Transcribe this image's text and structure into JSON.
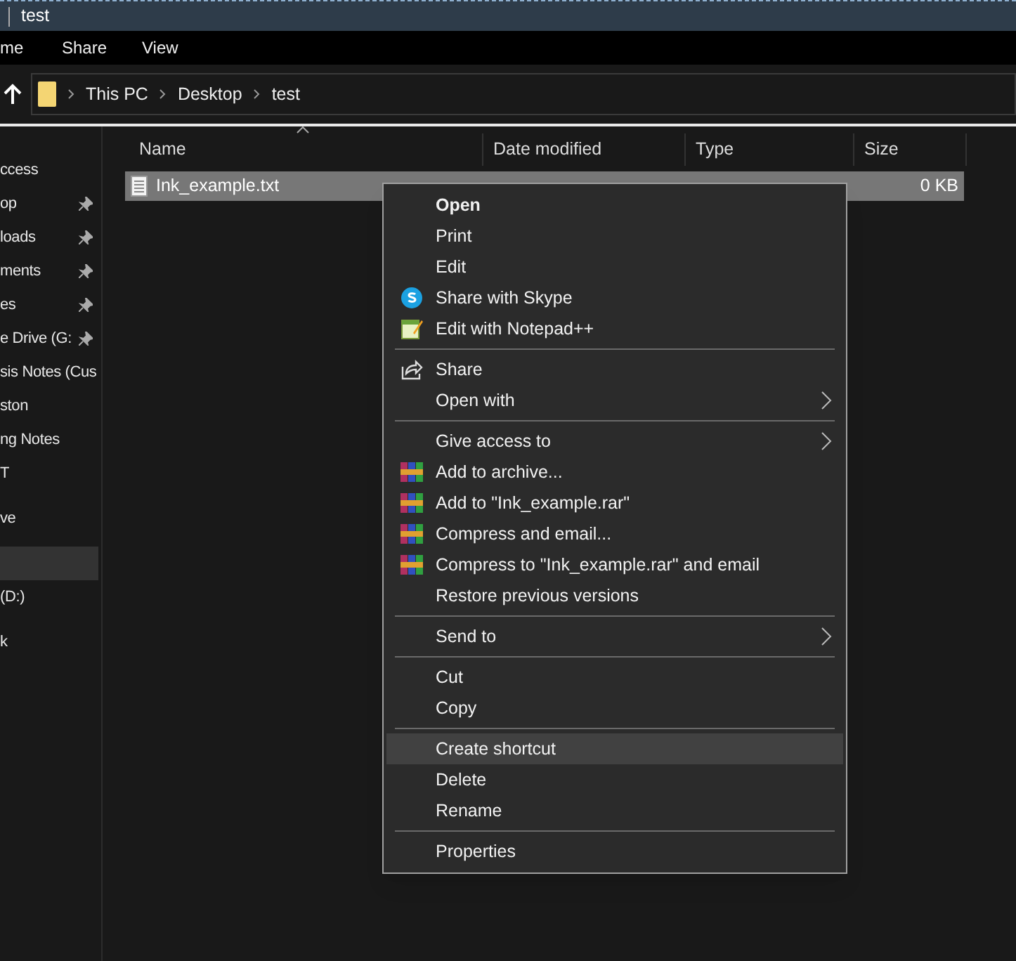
{
  "window": {
    "title": "test"
  },
  "ribbon_tabs": [
    {
      "label": "me"
    },
    {
      "label": "Share"
    },
    {
      "label": "View"
    }
  ],
  "address": {
    "crumbs": [
      "This PC",
      "Desktop",
      "test"
    ]
  },
  "sidebar": {
    "groups": [
      {
        "items": [
          {
            "label": "ccess",
            "pinned": false,
            "selected": false
          },
          {
            "label": "op",
            "pinned": true,
            "selected": false
          },
          {
            "label": "loads",
            "pinned": true,
            "selected": false
          },
          {
            "label": "ments",
            "pinned": true,
            "selected": false
          },
          {
            "label": "es",
            "pinned": true,
            "selected": false
          },
          {
            "label": "e Drive (G:",
            "pinned": true,
            "selected": false
          },
          {
            "label": "sis Notes (Cus",
            "pinned": false,
            "selected": false
          },
          {
            "label": "ston",
            "pinned": false,
            "selected": false
          },
          {
            "label": "ng Notes",
            "pinned": false,
            "selected": false
          },
          {
            "label": "T",
            "pinned": false,
            "selected": false
          }
        ]
      },
      {
        "items": [
          {
            "label": "ve",
            "pinned": false,
            "selected": false
          }
        ]
      },
      {
        "items": [
          {
            "pinned": false,
            "selected": true
          },
          {
            "label": "(D:)",
            "pinned": false,
            "selected": false
          }
        ]
      },
      {
        "items": [
          {
            "label": "k",
            "pinned": false,
            "selected": false
          }
        ]
      }
    ]
  },
  "table": {
    "columns": [
      "Name",
      "Date modified",
      "Type",
      "Size"
    ],
    "rows": [
      {
        "name": "Ink_example.txt",
        "size": "0 KB",
        "selected": true
      }
    ]
  },
  "context_menu": {
    "items": [
      {
        "kind": "item",
        "label": "Open",
        "default": true,
        "submenu": false,
        "selected": false
      },
      {
        "kind": "item",
        "label": "Print",
        "default": false,
        "submenu": false,
        "selected": false
      },
      {
        "kind": "item",
        "label": "Edit",
        "default": false,
        "submenu": false,
        "selected": false
      },
      {
        "kind": "skype",
        "label": "Share with Skype",
        "default": false,
        "submenu": false,
        "selected": false
      },
      {
        "kind": "notepad",
        "label": "Edit with Notepad++",
        "default": false,
        "submenu": false,
        "selected": false
      },
      {
        "kind": "separator"
      },
      {
        "kind": "share",
        "label": "Share",
        "default": false,
        "submenu": false,
        "selected": false
      },
      {
        "kind": "item",
        "label": "Open with",
        "default": false,
        "submenu": true,
        "selected": false
      },
      {
        "kind": "separator"
      },
      {
        "kind": "item",
        "label": "Give access to",
        "default": false,
        "submenu": true,
        "selected": false
      },
      {
        "kind": "archive",
        "label": "Add to archive...",
        "default": false,
        "submenu": false,
        "selected": false
      },
      {
        "kind": "archive",
        "label": "Add to \"Ink_example.rar\"",
        "default": false,
        "submenu": false,
        "selected": false
      },
      {
        "kind": "archive",
        "label": "Compress and email...",
        "default": false,
        "submenu": false,
        "selected": false
      },
      {
        "kind": "archive",
        "label": "Compress to \"Ink_example.rar\" and email",
        "default": false,
        "submenu": false,
        "selected": false
      },
      {
        "kind": "item",
        "label": "Restore previous versions",
        "default": false,
        "submenu": false,
        "selected": false
      },
      {
        "kind": "separator"
      },
      {
        "kind": "item",
        "label": "Send to",
        "default": false,
        "submenu": true,
        "selected": false
      },
      {
        "kind": "separator"
      },
      {
        "kind": "item",
        "label": "Cut",
        "default": false,
        "submenu": false,
        "selected": false
      },
      {
        "kind": "item",
        "label": "Copy",
        "default": false,
        "submenu": false,
        "selected": false
      },
      {
        "kind": "separator"
      },
      {
        "kind": "item",
        "label": "Create shortcut",
        "default": false,
        "submenu": false,
        "selected": true
      },
      {
        "kind": "item",
        "label": "Delete",
        "default": false,
        "submenu": false,
        "selected": false
      },
      {
        "kind": "item",
        "label": "Rename",
        "default": false,
        "submenu": false,
        "selected": false
      },
      {
        "kind": "separator"
      },
      {
        "kind": "item",
        "label": "Properties",
        "default": false,
        "submenu": false,
        "selected": false
      }
    ]
  }
}
